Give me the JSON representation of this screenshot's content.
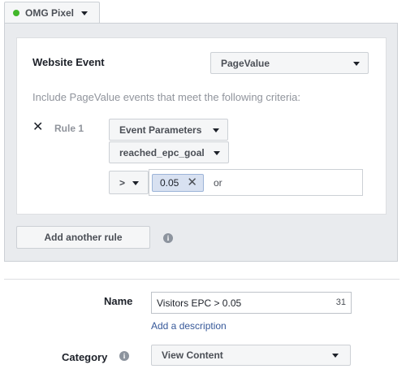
{
  "pixel": {
    "name": "OMG Pixel",
    "status_color": "#42b72a"
  },
  "rule_builder": {
    "website_event_label": "Website Event",
    "website_event_value": "PageValue",
    "criteria_text": "Include PageValue events that meet the following criteria:",
    "rule": {
      "label": "Rule 1",
      "remove_icon": "close-icon",
      "parameter_type": "Event Parameters",
      "parameter_name": "reached_epc_goal",
      "operator": ">",
      "values": [
        "0.05"
      ],
      "or_text": "or"
    },
    "add_rule_label": "Add another rule",
    "info_icon": "info-icon"
  },
  "audience_form": {
    "name_label": "Name",
    "name_value": "Visitors EPC > 0.05",
    "name_char_count": "31",
    "add_description_link": "Add a description",
    "category_label": "Category",
    "category_value": "View Content"
  },
  "colors": {
    "link": "#365899",
    "chip_bg": "#d8e1f1",
    "panel_bg": "#e9ebee"
  }
}
